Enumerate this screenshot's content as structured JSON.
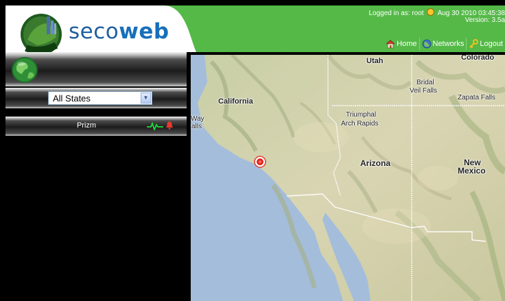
{
  "header": {
    "brand_prefix": "seco",
    "brand_suffix": "web",
    "status_prefix": "Logged in as: root",
    "datetime": "Aug 30 2010 03:45:38",
    "version": "Version: 3.5a",
    "nav": [
      {
        "label": "Home",
        "icon": "home-icon"
      },
      {
        "label": "Networks",
        "icon": "networks-icon"
      },
      {
        "label": "Logout",
        "icon": "key-icon"
      }
    ],
    "colors": {
      "header_bg": "#55b948",
      "brand_blue": "#1f5f9f"
    }
  },
  "sidebar": {
    "state_filter": {
      "selected": "All States"
    },
    "networks": [
      {
        "label": "Prizm",
        "status_icon": "heartbeat-icon",
        "alert_icon": "bell-icon",
        "status_color": "#1fdc3c",
        "alert_color": "#e83a2f"
      }
    ]
  },
  "map": {
    "labels": {
      "utah": "Utah",
      "colorado": "Colorado",
      "bridal": "Bridal",
      "veil_falls": "Veil Falls",
      "zapata_falls": "Zapata Falls",
      "california": "California",
      "way": "Way",
      "alls": "alls",
      "triumphal": "Triumphal",
      "arch_rapids": "Arch Rapids",
      "arizona": "Arizona",
      "new": "New",
      "mexico": "Mexico"
    },
    "marker_icon": "location-marker-icon"
  }
}
